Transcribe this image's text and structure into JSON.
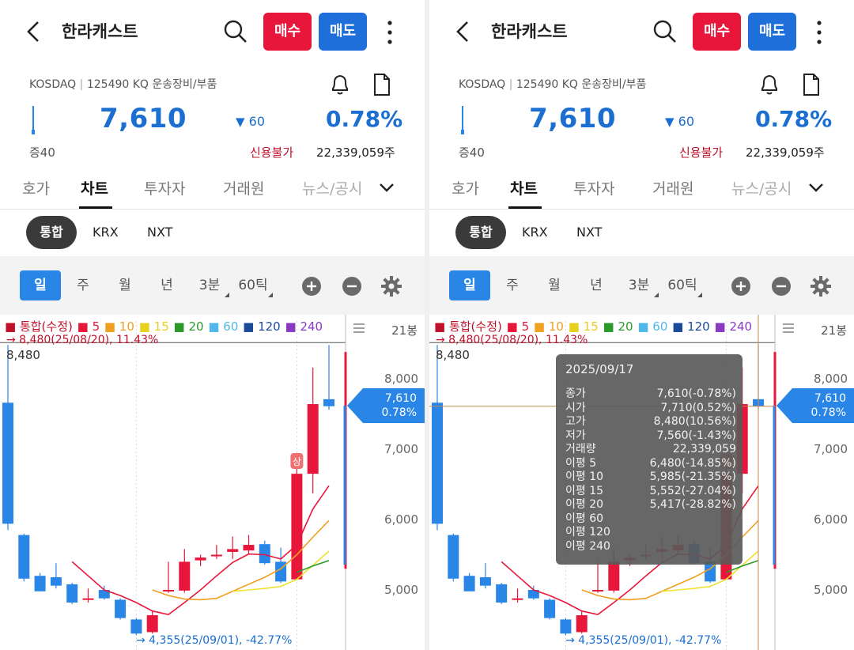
{
  "header": {
    "title": "한라캐스트",
    "buy_label": "매수",
    "sell_label": "매도"
  },
  "info": {
    "market": "KOSDAQ",
    "code": "125490 KQ",
    "sector": "운송장비/부품"
  },
  "quote": {
    "price": "7,610",
    "change": "60",
    "change_pct": "0.78%",
    "margin_rate": "증40",
    "credit": "신용불가",
    "volume": "22,339,059주"
  },
  "tabs": [
    "호가",
    "차트",
    "투자자",
    "거래원",
    "뉴스/공시"
  ],
  "market_tabs": [
    "통합",
    "KRX",
    "NXT"
  ],
  "periods": [
    "일",
    "주",
    "월",
    "년",
    "3분",
    "60틱"
  ],
  "legend": {
    "series": "■ 통합(수정)",
    "ma": [
      "■ 5",
      "■ 10",
      "■ 15",
      "■ 20",
      "■ 60",
      "■ 120",
      "■ 240"
    ]
  },
  "colors": {
    "up": "#e8163a",
    "down": "#2a86e6",
    "ma5": "#e8163a",
    "ma10": "#f0a020",
    "ma15": "#f0e030",
    "ma20": "#2a9a2a",
    "ma60": "#50b8e8",
    "ma120": "#1a4a9a",
    "ma240": "#8a3ac0"
  },
  "chart_labels": {
    "max_note": "→ 8,480(25/08/20), 11.43%",
    "max_value": "8,480",
    "min_note": "→ 4,355(25/09/01), -42.77%",
    "bars": "21봉",
    "axis": [
      "8,000",
      "7,000",
      "6,000",
      "5,000"
    ],
    "badge": "상",
    "current_price": "7,610",
    "current_pct": "0.78%"
  },
  "chart_data": {
    "type": "candlestick",
    "y_axis_ticks": [
      8000,
      7000,
      6000,
      5000
    ],
    "bars_shown": 21,
    "high_marker": {
      "value": 8480,
      "date": "25/08/20",
      "pct": 11.43
    },
    "low_marker": {
      "value": 4355,
      "date": "25/09/01",
      "pct": -42.77
    },
    "candles": [
      {
        "o": 7660,
        "h": 8480,
        "l": 5850,
        "c": 5940
      },
      {
        "o": 5780,
        "h": 5800,
        "l": 5120,
        "c": 5160
      },
      {
        "o": 5200,
        "h": 5240,
        "l": 4980,
        "c": 4980
      },
      {
        "o": 5180,
        "h": 5380,
        "l": 5020,
        "c": 5060
      },
      {
        "o": 5080,
        "h": 5100,
        "l": 4800,
        "c": 4820
      },
      {
        "o": 4860,
        "h": 5020,
        "l": 4820,
        "c": 4880
      },
      {
        "o": 5000,
        "h": 5060,
        "l": 4860,
        "c": 4880
      },
      {
        "o": 4860,
        "h": 4880,
        "l": 4580,
        "c": 4600
      },
      {
        "o": 4580,
        "h": 4600,
        "l": 4355,
        "c": 4380
      },
      {
        "o": 4400,
        "h": 4700,
        "l": 4380,
        "c": 4640
      },
      {
        "o": 4990,
        "h": 5400,
        "l": 4960,
        "c": 5000
      },
      {
        "o": 4990,
        "h": 5580,
        "l": 4960,
        "c": 5400
      },
      {
        "o": 5420,
        "h": 5500,
        "l": 5340,
        "c": 5460
      },
      {
        "o": 5480,
        "h": 5640,
        "l": 5440,
        "c": 5500
      },
      {
        "o": 5540,
        "h": 5760,
        "l": 5440,
        "c": 5580
      },
      {
        "o": 5560,
        "h": 5780,
        "l": 5500,
        "c": 5640
      },
      {
        "o": 5650,
        "h": 5700,
        "l": 5360,
        "c": 5380
      },
      {
        "o": 5400,
        "h": 5600,
        "l": 5100,
        "c": 5120
      },
      {
        "o": 5150,
        "h": 6800,
        "l": 5140,
        "c": 6650
      },
      {
        "o": 6650,
        "h": 8160,
        "l": 6370,
        "c": 7640
      },
      {
        "o": 7710,
        "h": 8480,
        "l": 7560,
        "c": 7610
      }
    ],
    "ma5": [
      null,
      null,
      null,
      null,
      5400,
      5200,
      5000,
      4920,
      4820,
      4700,
      4650,
      4820,
      5000,
      5200,
      5390,
      5510,
      5500,
      5440,
      5640,
      6150,
      6480
    ],
    "ma10": [
      null,
      null,
      null,
      null,
      null,
      null,
      null,
      null,
      null,
      5000,
      4920,
      4870,
      4860,
      4880,
      4980,
      5080,
      5180,
      5300,
      5500,
      5750,
      5985
    ],
    "ma15": [
      null,
      null,
      null,
      null,
      null,
      null,
      null,
      null,
      null,
      null,
      null,
      null,
      null,
      null,
      4980,
      5000,
      5020,
      5050,
      5150,
      5350,
      5552
    ],
    "ma20": [
      null,
      null,
      null,
      null,
      null,
      null,
      null,
      null,
      null,
      null,
      null,
      null,
      null,
      null,
      null,
      null,
      null,
      null,
      5250,
      5340,
      5417
    ]
  },
  "tooltip": {
    "date": "2025/09/17",
    "rows": [
      {
        "label": "종가",
        "value": "7,610(-0.78%)"
      },
      {
        "label": "시가",
        "value": "7,710(0.52%)"
      },
      {
        "label": "고가",
        "value": "8,480(10.56%)"
      },
      {
        "label": "저가",
        "value": "7,560(-1.43%)"
      },
      {
        "label": "거래량",
        "value": "22,339,059"
      },
      {
        "label": "이평 5",
        "value": "6,480(-14.85%)"
      },
      {
        "label": "이평 10",
        "value": "5,985(-21.35%)"
      },
      {
        "label": "이평 15",
        "value": "5,552(-27.04%)"
      },
      {
        "label": "이평 20",
        "value": "5,417(-28.82%)"
      },
      {
        "label": "이평 60",
        "value": ""
      },
      {
        "label": "이평 120",
        "value": ""
      },
      {
        "label": "이평 240",
        "value": ""
      }
    ]
  }
}
